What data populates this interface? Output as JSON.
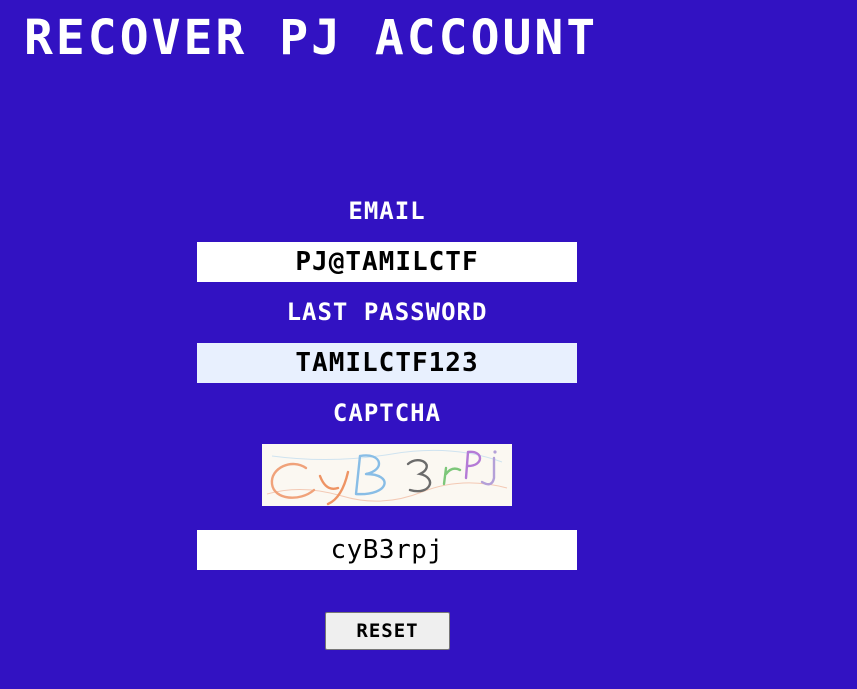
{
  "page": {
    "title": "RECOVER PJ ACCOUNT"
  },
  "form": {
    "email_label": "EMAIL",
    "email_value": "PJ@TAMILCTF",
    "password_label": "LAST PASSWORD",
    "password_value": "TAMILCTF123",
    "captcha_label": "CAPTCHA",
    "captcha_image_text": "CyB3rPj",
    "captcha_input_value": "cyB3rpj",
    "reset_label": "RESET"
  },
  "colors": {
    "background": "#3212c2",
    "text": "#ffffff",
    "password_field_background": "#e8f0fe"
  }
}
